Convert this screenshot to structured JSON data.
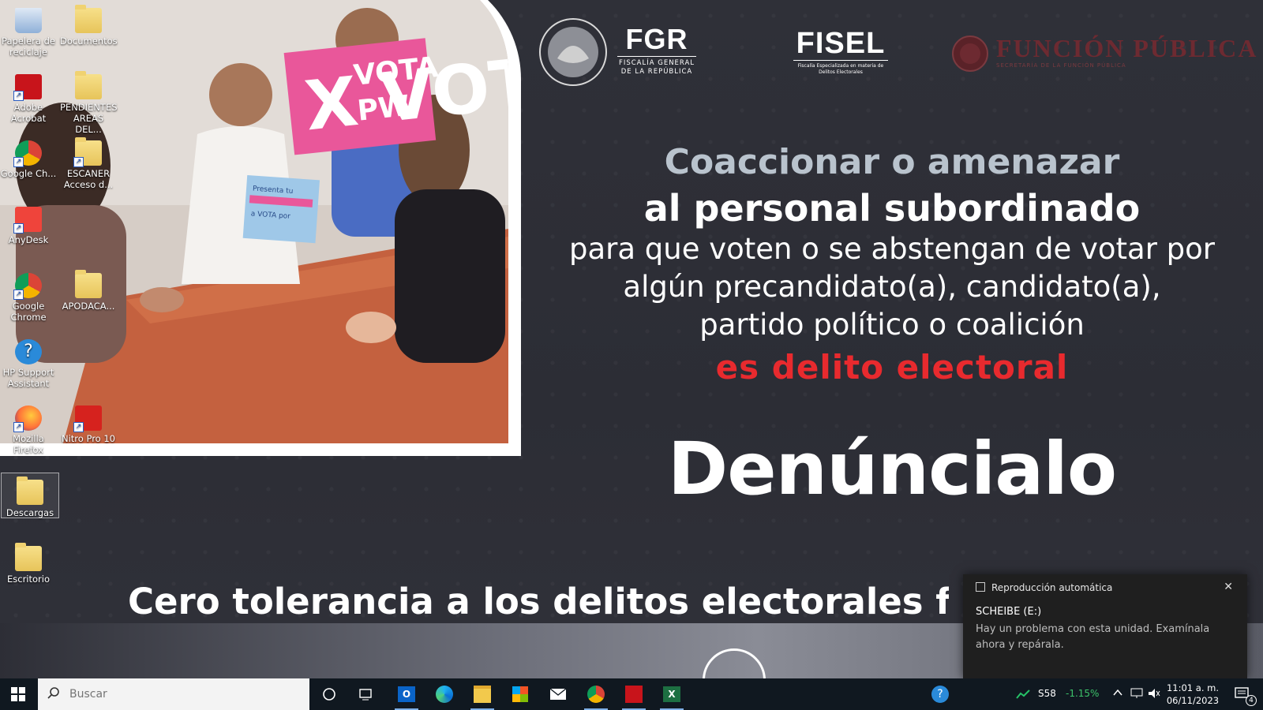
{
  "wallpaper": {
    "logos": {
      "fgr_big": "FGR",
      "fgr_small": "FISCALÍA GENERAL DE LA REPÚBLICA",
      "fisel_big": "FISEL",
      "fisel_small": "Fiscalía Especializada en materia de Delitos Electorales",
      "fp_big": "FUNCIÓN PÚBLICA",
      "fp_small": "SECRETARÍA DE LA FUNCIÓN PÚBLICA"
    },
    "headline_1": "Coaccionar o amenazar",
    "headline_2": "al personal subordinado",
    "body_line_1": "para que voten o se abstengan de votar por",
    "body_line_2": "algún precandidato(a), candidato(a),",
    "body_line_3": "partido político o coalición",
    "delito": "es delito electoral",
    "denuncia": "Denúncialo",
    "cero": "Cero tolerancia a los delitos electorales fe",
    "sign_1": "X VOTA",
    "sign_1b": "PW",
    "sign_2": "Presenta tu credencial a VOTA por",
    "colors": {
      "accent_red": "#e82a2e",
      "headline_gray": "#b9c3cd",
      "fp_wine": "#6d2a31"
    }
  },
  "desktop_icons": [
    {
      "label": "Papelera de reciclaje",
      "icon": "recycle-bin-icon"
    },
    {
      "label": "Documentos",
      "icon": "folder-icon"
    },
    {
      "label": "Adobe Acrobat",
      "icon": "acrobat-icon"
    },
    {
      "label": "PENDIENTES AREAS DEL...",
      "icon": "folder-icon"
    },
    {
      "label": "Google Ch...",
      "icon": "chrome-icon"
    },
    {
      "label": "ESCANER Acceso d...",
      "icon": "folder-icon"
    },
    {
      "label": "AnyDesk",
      "icon": "anydesk-icon"
    },
    {
      "label": "Google Chrome",
      "icon": "chrome-icon"
    },
    {
      "label": "APODACA...",
      "icon": "folder-icon"
    },
    {
      "label": "HP Support Assistant",
      "icon": "hp-support-icon"
    },
    {
      "label": "Mozilla Firefox",
      "icon": "firefox-icon"
    },
    {
      "label": "Nitro Pro 10",
      "icon": "nitro-icon"
    },
    {
      "label": "Descargas",
      "icon": "folder-icon"
    },
    {
      "label": "Escritorio",
      "icon": "folder-icon"
    }
  ],
  "notification": {
    "header": "Reproducción automática",
    "title": "SCHEIBE (E:)",
    "message": "Hay un problema con esta unidad. Examínala ahora y repárala.",
    "close_glyph": "✕"
  },
  "taskbar": {
    "search_placeholder": "Buscar",
    "stock_name": "S58",
    "stock_change": "-1.15%",
    "time": "11:01 a. m.",
    "date": "06/11/2023",
    "notification_count": "4"
  }
}
